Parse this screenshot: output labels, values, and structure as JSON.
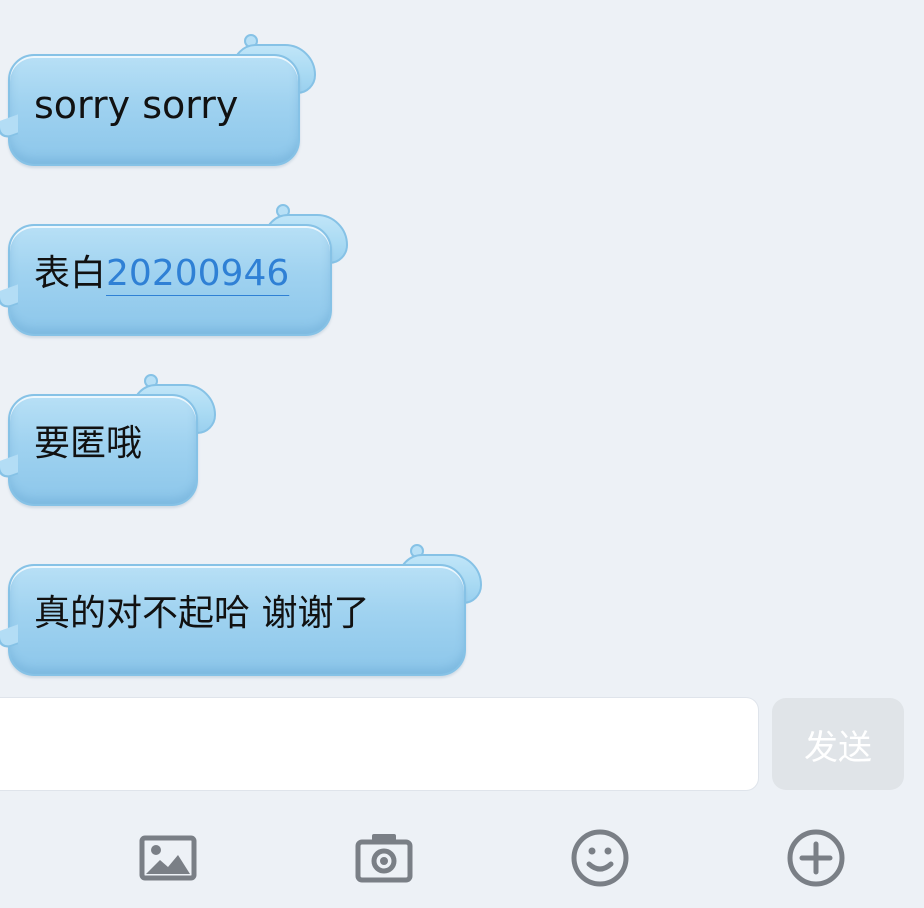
{
  "messages": [
    {
      "segments": [
        {
          "text": "sorry sorry",
          "type": "text"
        }
      ]
    },
    {
      "segments": [
        {
          "text": "表白",
          "type": "text"
        },
        {
          "text": "20200946",
          "type": "link"
        }
      ]
    },
    {
      "segments": [
        {
          "text": "要匿哦",
          "type": "text"
        }
      ]
    },
    {
      "segments": [
        {
          "text": "真的对不起哈 谢谢了",
          "type": "text"
        }
      ]
    }
  ],
  "input": {
    "placeholder": "",
    "value": ""
  },
  "send_button": {
    "label": "发送"
  },
  "toolbar": {
    "items": [
      {
        "icon": "image-icon"
      },
      {
        "icon": "camera-icon"
      },
      {
        "icon": "emoji-icon"
      },
      {
        "icon": "add-circle-icon"
      }
    ]
  },
  "colors": {
    "background": "#edf1f6",
    "bubble": "#9fd2f0",
    "link": "#2f80d5",
    "send_button": "#e0e4e8",
    "icon": "#7a7f86"
  }
}
